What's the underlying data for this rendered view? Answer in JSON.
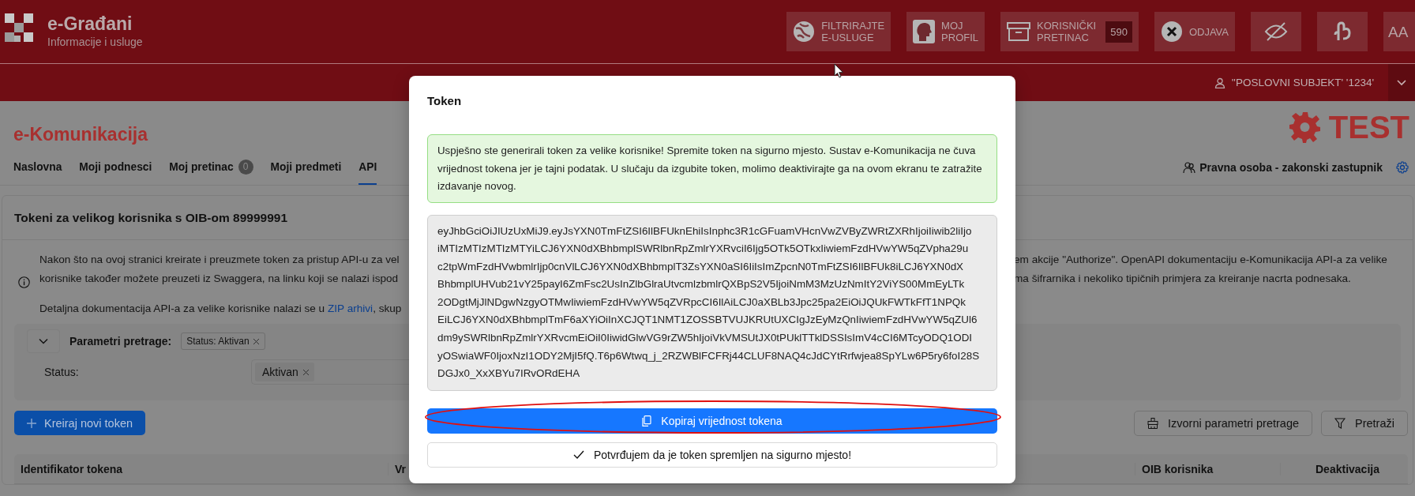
{
  "header": {
    "title": "e-Građani",
    "subtitle": "Informacije i usluge",
    "buttons": [
      {
        "kind": "labeled",
        "lines": [
          "FILTRIRAJTE",
          "E-USLUGE"
        ]
      },
      {
        "kind": "labeled",
        "lines": [
          "MOJ",
          "PROFIL"
        ]
      },
      {
        "kind": "labeled",
        "lines": [
          "KORISNIČKI",
          "PRETINAC"
        ],
        "badge": "590"
      },
      {
        "kind": "labeled",
        "lines": [
          "ODJAVA"
        ]
      },
      {
        "kind": "icon"
      },
      {
        "kind": "icon"
      },
      {
        "kind": "text",
        "label": "AA"
      }
    ]
  },
  "user_bar": {
    "user": "''POSLOVNI SUBJEKT' '1234'"
  },
  "app_title": "e-Komunikacija",
  "env_label": "TEST",
  "tabs": [
    {
      "label": "Naslovna",
      "selected": false
    },
    {
      "label": "Moji podnesci",
      "selected": false
    },
    {
      "label": "Moj pretinac",
      "badge": "0",
      "selected": false
    },
    {
      "label": "Moji predmeti",
      "selected": false
    },
    {
      "label": "API",
      "selected": true
    }
  ],
  "role": "Pravna osoba - zakonski zastupnik",
  "card": {
    "title": "Tokeni za velikog korisnika s OIB-om 89999991",
    "info_lines": [
      {
        "left": "Nakon što na ovoj stranici kreirate i preuzmete token za pristup API-u za vel",
        "right": "em akcije \"Authorize\". OpenAPI dokumentaciju e-Komunikacija API-a za velike"
      },
      {
        "left": "korisnike također možete preuzeti iz Swaggera, na linku koji se nalazi ispod",
        "right": "ma šifrarnika i nekoliko tipičnih primjera za kreiranje nacrta podnesaka."
      }
    ],
    "doc_line": {
      "before": "Detaljna dokumentacija API-a za velike korisnike nalazi se u ",
      "link": "ZIP arhivi",
      "after": ", skup"
    },
    "filter": {
      "expanded": true,
      "label": "Parametri pretrage:",
      "chips": [
        "Status: Aktivan"
      ],
      "fields": [
        {
          "label": "Status:",
          "values": [
            "Aktivan"
          ]
        }
      ]
    },
    "create_button": "Kreiraj novi token",
    "reset_button": "Izvorni parametri pretrage",
    "search_button": "Pretraži",
    "table": {
      "columns": [
        "Identifikator tokena",
        "Vr",
        "OIB korisnika",
        "Deaktivacija"
      ]
    }
  },
  "modal": {
    "title": "Token",
    "message": "Uspješno ste generirali token za velike korisnike! Spremite token na sigurno mjesto. Sustav e-Komunikacija ne čuva vrijednost tokena jer je tajni podatak. U slučaju da izgubite token, molimo deaktivirajte ga na ovom ekranu te zatražite izdavanje novog.",
    "token_lines": [
      "eyJhbGciOiJIUzUxMiJ9.eyJsYXN0TmFtZSI6IlBFUknEhiIsInphc3R1cGFuamVHcnVwZVByZWRtZXRhIjoiIiwib2liIjo",
      "iMTIzMTIzMTIzMTYiLCJ6YXN0dXBhbmplSWRlbnRpZmlrYXRvciI6Ijg5OTk5OTkxIiwiemFzdHVwYW5qZVpha29u",
      "c2tpWmFzdHVwbmlrIjp0cnVlLCJ6YXN0dXBhbmplT3ZsYXN0aSI6IiIsImZpcnN0TmFtZSI6IlBFUk8iLCJ6YXN0dX",
      "BhbmplUHVub21vY25payI6ZmFsc2UsInZlbGlraUtvcmlzbmlrQXBpS2V5IjoiNmM3MzUzNmItY2ViYS00MmEyLTk",
      "2ODgtMjJlNDgwNzgyOTMwIiwiemFzdHVwYW5qZVRpcCI6IlAiLCJ0aXBLb3Jpc25pa2EiOiJQUkFWTkFfT1NPQk",
      "EiLCJ6YXN0dXBhbmplTmF6aXYiOiInXCJQT1NMT1ZOSSBTVUJKRUtUXCIgJzEyMzQnIiwiemFzdHVwYW5qZUl6",
      "dm9ySWRlbnRpZmlrYXRvcmEiOiI0IiwidGlwVG9rZW5hIjoiVkVMSUtJX0tPUklTTklDSSIsImV4cCI6MTcyODQ1ODI",
      "yOSwiaWF0IjoxNzI1ODY2MjI5fQ.T6p6Wtwq_j_2RZWBlFCFRj44CLUF8NAQ4cJdCYtRrfwjea8SpYLw6P5ry6foI28S",
      "DGJx0_XxXBYu7IRvORdEHA"
    ],
    "copy_button": "Kopiraj vrijednost tokena",
    "confirm_button": "Potvrđujem da je token spremljen na sigurno mjesto!"
  }
}
